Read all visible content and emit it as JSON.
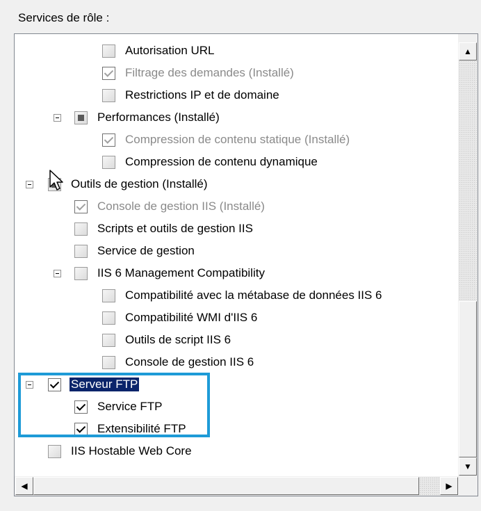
{
  "header": {
    "title": "Services de rôle :"
  },
  "tree": {
    "items": [
      {
        "label": "Autorisation URL",
        "state": "unchecked",
        "disabled": false
      },
      {
        "label": "Filtrage des demandes  (Installé)",
        "state": "checked",
        "disabled": true
      },
      {
        "label": "Restrictions IP et de domaine",
        "state": "unchecked",
        "disabled": false
      },
      {
        "label": "Performances  (Installé)",
        "state": "partial",
        "disabled": false
      },
      {
        "label": "Compression de contenu statique  (Installé)",
        "state": "checked",
        "disabled": true
      },
      {
        "label": "Compression de contenu dynamique",
        "state": "unchecked",
        "disabled": false
      },
      {
        "label": "Outils de gestion  (Installé)",
        "state": "partial",
        "disabled": false
      },
      {
        "label": "Console de gestion IIS  (Installé)",
        "state": "checked",
        "disabled": true
      },
      {
        "label": "Scripts et outils de gestion IIS",
        "state": "unchecked",
        "disabled": false
      },
      {
        "label": "Service de gestion",
        "state": "unchecked",
        "disabled": false
      },
      {
        "label": "IIS 6 Management Compatibility",
        "state": "unchecked",
        "disabled": false
      },
      {
        "label": "Compatibilité avec la métabase de données IIS 6",
        "state": "unchecked",
        "disabled": false
      },
      {
        "label": "Compatibilité WMI d'IIS 6",
        "state": "unchecked",
        "disabled": false
      },
      {
        "label": "Outils de script IIS 6",
        "state": "unchecked",
        "disabled": false
      },
      {
        "label": "Console de gestion IIS 6",
        "state": "unchecked",
        "disabled": false
      },
      {
        "label": "Serveur FTP",
        "state": "checked",
        "disabled": false,
        "selected": true
      },
      {
        "label": "Service FTP",
        "state": "checked",
        "disabled": false
      },
      {
        "label": "Extensibilité FTP",
        "state": "checked",
        "disabled": false
      },
      {
        "label": "IIS Hostable Web Core",
        "state": "unchecked",
        "disabled": false
      }
    ]
  },
  "scrollbar": {
    "up_arrow": "▲",
    "down_arrow": "▼",
    "left_arrow": "◀",
    "right_arrow": "▶",
    "position": 0.85
  },
  "highlight_color": "#1e9bd7",
  "selection_color": "#0a246a"
}
